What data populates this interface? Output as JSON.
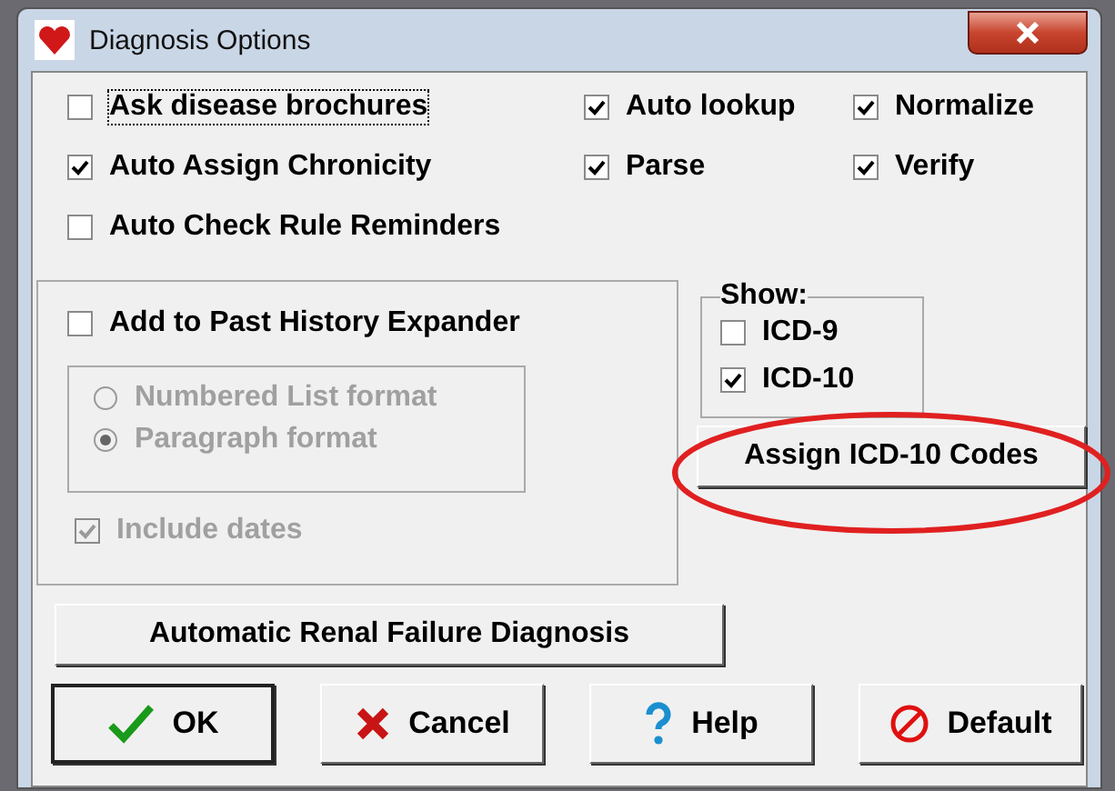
{
  "window": {
    "title": "Diagnosis Options"
  },
  "options": [
    {
      "label": "Ask disease brochures",
      "checked": false,
      "focused": true
    },
    {
      "label": "Auto lookup",
      "checked": true,
      "focused": false
    },
    {
      "label": "Normalize",
      "checked": true,
      "focused": false
    },
    {
      "label": "Auto Assign Chronicity",
      "checked": true,
      "focused": false
    },
    {
      "label": "Parse",
      "checked": true,
      "focused": false
    },
    {
      "label": "Verify",
      "checked": true,
      "focused": false
    },
    {
      "label": "Auto Check Rule Reminders",
      "checked": false,
      "focused": false
    }
  ],
  "history": {
    "label": "Add to Past History Expander",
    "checked": false,
    "formats": [
      {
        "label": "Numbered List format",
        "selected": false,
        "disabled": true
      },
      {
        "label": "Paragraph format",
        "selected": true,
        "disabled": true
      }
    ],
    "include_dates": {
      "label": "Include dates",
      "checked": true,
      "disabled": true
    }
  },
  "show": {
    "title": "Show:",
    "items": [
      {
        "label": "ICD-9",
        "checked": false
      },
      {
        "label": "ICD-10",
        "checked": true
      }
    ]
  },
  "assign_button": {
    "label": "Assign ICD-10 Codes",
    "highlighted": true
  },
  "renal_button": "Automatic Renal Failure Diagnosis",
  "buttons": [
    {
      "kind": "ok",
      "label": "OK"
    },
    {
      "kind": "cancel",
      "label": "Cancel"
    },
    {
      "kind": "help",
      "label": "Help"
    },
    {
      "kind": "default",
      "label": "Default"
    }
  ]
}
